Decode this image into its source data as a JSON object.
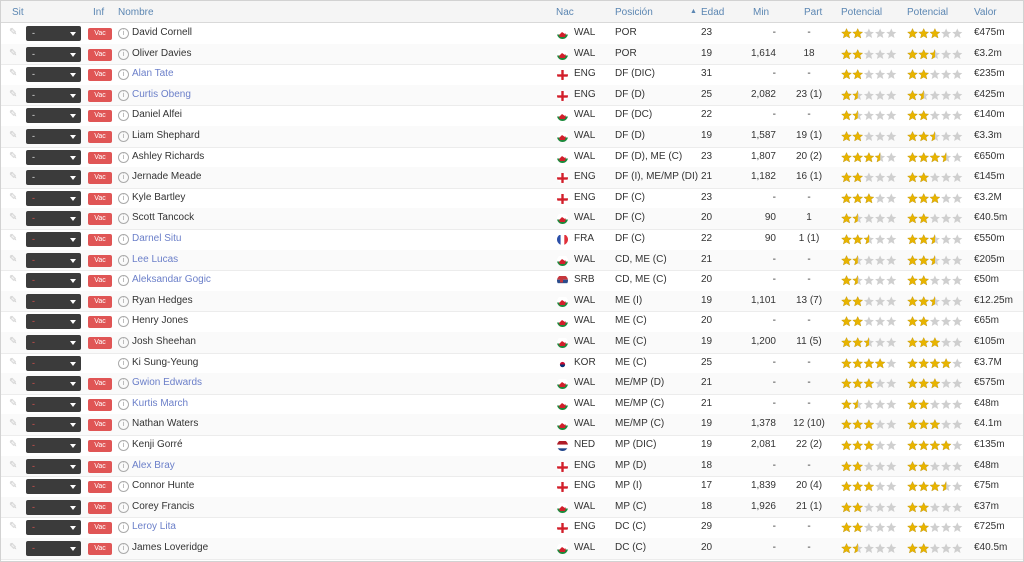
{
  "headers": {
    "sit": "Sit",
    "inf": "Inf",
    "nombre": "Nombre",
    "nac": "Nac",
    "posicion": "Posición",
    "edad": "Edad",
    "min": "Min",
    "part": "Part",
    "potencial1": "Potencial",
    "potencial2": "Potencial",
    "valor": "Valor"
  },
  "sort_icon": "sort-ascending-icon",
  "colors": {
    "header_text": "#5b86b2",
    "vac_badge": "#e05555",
    "dropdown": "#3b3b3b",
    "link_name": "#6b7fc9",
    "star": "#e8b400"
  },
  "players": [
    {
      "dd": "-",
      "dd_red": false,
      "badge": "Vac",
      "name": "David Cornell",
      "link": false,
      "nac": "WAL",
      "pos": "POR",
      "edad": "23",
      "min": "-",
      "part": "-",
      "cur": 2,
      "pot": 3,
      "valor": "€475m"
    },
    {
      "dd": "-",
      "dd_red": false,
      "badge": "Vac",
      "name": "Oliver Davies",
      "link": false,
      "nac": "WAL",
      "pos": "POR",
      "edad": "19",
      "min": "1,614",
      "part": "18",
      "cur": 2,
      "pot": 2.5,
      "valor": "€3.2m"
    },
    {
      "dd": "-",
      "dd_red": false,
      "badge": "Vac",
      "name": "Alan Tate",
      "link": true,
      "nac": "ENG",
      "pos": "DF (DIC)",
      "edad": "31",
      "min": "-",
      "part": "-",
      "cur": 2,
      "pot": 2,
      "valor": "€235m"
    },
    {
      "dd": "-",
      "dd_red": false,
      "badge": "Vac",
      "name": "Curtis Obeng",
      "link": true,
      "nac": "ENG",
      "pos": "DF (D)",
      "edad": "25",
      "min": "2,082",
      "part": "23 (1)",
      "cur": 1.5,
      "pot": 1.5,
      "valor": "€425m"
    },
    {
      "dd": "-",
      "dd_red": false,
      "badge": "Vac",
      "name": "Daniel Alfei",
      "link": false,
      "nac": "WAL",
      "pos": "DF (DC)",
      "edad": "22",
      "min": "-",
      "part": "-",
      "cur": 1.5,
      "pot": 2,
      "valor": "€140m"
    },
    {
      "dd": "-",
      "dd_red": false,
      "badge": "Vac",
      "name": "Liam Shephard",
      "link": false,
      "nac": "WAL",
      "pos": "DF (D)",
      "edad": "19",
      "min": "1,587",
      "part": "19 (1)",
      "cur": 2,
      "pot": 2.5,
      "valor": "€3.3m"
    },
    {
      "dd": "-",
      "dd_red": false,
      "badge": "Vac",
      "name": "Ashley Richards",
      "link": false,
      "nac": "WAL",
      "pos": "DF (D), ME (C)",
      "edad": "23",
      "min": "1,807",
      "part": "20 (2)",
      "cur": 3.5,
      "pot": 3.5,
      "valor": "€650m"
    },
    {
      "dd": "-",
      "dd_red": false,
      "badge": "Vac",
      "name": "Jernade Meade",
      "link": false,
      "nac": "ENG",
      "pos": "DF (I), ME/MP (DI)",
      "edad": "21",
      "min": "1,182",
      "part": "16 (1)",
      "cur": 2,
      "pot": 2,
      "valor": "€145m"
    },
    {
      "dd": "-",
      "dd_red": true,
      "badge": "Vac",
      "name": "Kyle Bartley",
      "link": false,
      "nac": "ENG",
      "pos": "DF (C)",
      "edad": "23",
      "min": "-",
      "part": "-",
      "cur": 3,
      "pot": 3,
      "valor": "€3.2M"
    },
    {
      "dd": "-",
      "dd_red": true,
      "badge": "Vac",
      "name": "Scott Tancock",
      "link": false,
      "nac": "WAL",
      "pos": "DF (C)",
      "edad": "20",
      "min": "90",
      "part": "1",
      "cur": 1.5,
      "pot": 2,
      "valor": "€40.5m"
    },
    {
      "dd": "-",
      "dd_red": true,
      "badge": "Vac",
      "name": "Darnel Situ",
      "link": true,
      "nac": "FRA",
      "pos": "DF (C)",
      "edad": "22",
      "min": "90",
      "part": "1 (1)",
      "cur": 2.5,
      "pot": 2.5,
      "valor": "€550m"
    },
    {
      "dd": "-",
      "dd_red": true,
      "badge": "Vac",
      "name": "Lee Lucas",
      "link": true,
      "nac": "WAL",
      "pos": "CD, ME (C)",
      "edad": "21",
      "min": "-",
      "part": "-",
      "cur": 1.5,
      "pot": 2.5,
      "valor": "€205m"
    },
    {
      "dd": "-",
      "dd_red": true,
      "badge": "Vac",
      "name": "Aleksandar Gogic",
      "link": true,
      "nac": "SRB",
      "pos": "CD, ME (C)",
      "edad": "20",
      "min": "-",
      "part": "-",
      "cur": 1.5,
      "pot": 2,
      "valor": "€50m"
    },
    {
      "dd": "-",
      "dd_red": true,
      "badge": "Vac",
      "name": "Ryan Hedges",
      "link": false,
      "nac": "WAL",
      "pos": "ME (I)",
      "edad": "19",
      "min": "1,101",
      "part": "13 (7)",
      "cur": 2,
      "pot": 2.5,
      "valor": "€12.25m"
    },
    {
      "dd": "-",
      "dd_red": true,
      "badge": "Vac",
      "name": "Henry Jones",
      "link": false,
      "nac": "WAL",
      "pos": "ME (C)",
      "edad": "20",
      "min": "-",
      "part": "-",
      "cur": 2,
      "pot": 2,
      "valor": "€65m"
    },
    {
      "dd": "-",
      "dd_red": true,
      "badge": "Vac",
      "name": "Josh Sheehan",
      "link": false,
      "nac": "WAL",
      "pos": "ME (C)",
      "edad": "19",
      "min": "1,200",
      "part": "11 (5)",
      "cur": 2.5,
      "pot": 3,
      "valor": "€105m"
    },
    {
      "dd": "-",
      "dd_red": true,
      "badge": "",
      "name": "Ki Sung-Yeung",
      "link": false,
      "nac": "KOR",
      "pos": "ME (C)",
      "edad": "25",
      "min": "-",
      "part": "-",
      "cur": 4,
      "pot": 4,
      "valor": "€3.7M"
    },
    {
      "dd": "-",
      "dd_red": true,
      "badge": "Vac",
      "name": "Gwion Edwards",
      "link": true,
      "nac": "WAL",
      "pos": "ME/MP (D)",
      "edad": "21",
      "min": "-",
      "part": "-",
      "cur": 3,
      "pot": 3,
      "valor": "€575m"
    },
    {
      "dd": "-",
      "dd_red": true,
      "badge": "Vac",
      "name": "Kurtis March",
      "link": true,
      "nac": "WAL",
      "pos": "ME/MP (C)",
      "edad": "21",
      "min": "-",
      "part": "-",
      "cur": 1.5,
      "pot": 2,
      "valor": "€48m"
    },
    {
      "dd": "-",
      "dd_red": true,
      "badge": "Vac",
      "name": "Nathan Waters",
      "link": false,
      "nac": "WAL",
      "pos": "ME/MP (C)",
      "edad": "19",
      "min": "1,378",
      "part": "12 (10)",
      "cur": 3,
      "pot": 3,
      "valor": "€4.1m"
    },
    {
      "dd": "-",
      "dd_red": true,
      "badge": "Vac",
      "name": "Kenji Gorré",
      "link": false,
      "nac": "NED",
      "pos": "MP (DIC)",
      "edad": "19",
      "min": "2,081",
      "part": "22 (2)",
      "cur": 3,
      "pot": 4,
      "valor": "€135m"
    },
    {
      "dd": "-",
      "dd_red": true,
      "badge": "Vac",
      "name": "Alex Bray",
      "link": true,
      "nac": "ENG",
      "pos": "MP (D)",
      "edad": "18",
      "min": "-",
      "part": "-",
      "cur": 2,
      "pot": 2,
      "valor": "€48m"
    },
    {
      "dd": "-",
      "dd_red": true,
      "badge": "Vac",
      "name": "Connor Hunte",
      "link": false,
      "nac": "ENG",
      "pos": "MP (I)",
      "edad": "17",
      "min": "1,839",
      "part": "20 (4)",
      "cur": 3,
      "pot": 3.5,
      "valor": "€75m"
    },
    {
      "dd": "-",
      "dd_red": true,
      "badge": "Vac",
      "name": "Corey Francis",
      "link": false,
      "nac": "WAL",
      "pos": "MP (C)",
      "edad": "18",
      "min": "1,926",
      "part": "21 (1)",
      "cur": 2,
      "pot": 2,
      "valor": "€37m"
    },
    {
      "dd": "-",
      "dd_red": true,
      "badge": "Vac",
      "name": "Leroy Lita",
      "link": true,
      "nac": "ENG",
      "pos": "DC (C)",
      "edad": "29",
      "min": "-",
      "part": "-",
      "cur": 2,
      "pot": 2,
      "valor": "€725m"
    },
    {
      "dd": "-",
      "dd_red": true,
      "badge": "Vac",
      "name": "James Loveridge",
      "link": false,
      "nac": "WAL",
      "pos": "DC (C)",
      "edad": "20",
      "min": "-",
      "part": "-",
      "cur": 1.5,
      "pot": 2,
      "valor": "€40.5m"
    }
  ]
}
